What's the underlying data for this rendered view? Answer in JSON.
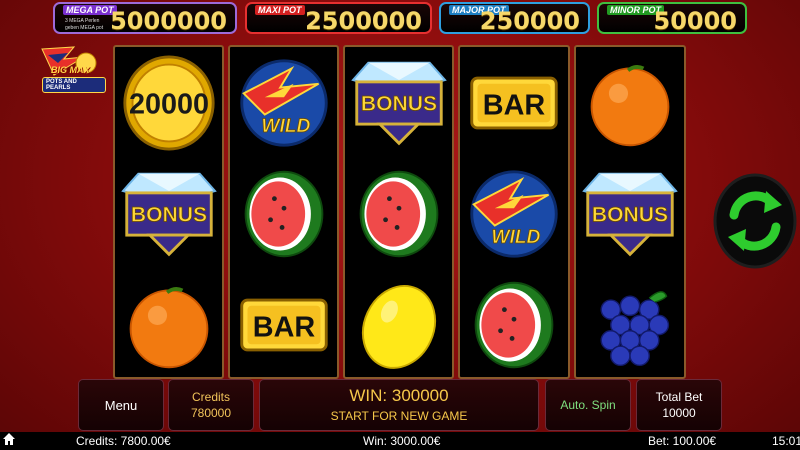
{
  "jackpots": {
    "mega": {
      "title": "MEGA POT",
      "sub1": "3 MEGA Perlen",
      "sub2": "geben MEGA pot",
      "value": "5000000"
    },
    "maxi": {
      "title": "MAXI POT",
      "value": "2500000"
    },
    "major": {
      "title": "MAJOR POT",
      "value": "250000"
    },
    "minor": {
      "title": "MINOR POT",
      "value": "50000"
    }
  },
  "logo": {
    "line1": "BIG MAX",
    "line2": "POTS AND PEARLS"
  },
  "reels": [
    [
      "coin-20000",
      "bonus-diamond",
      "orange"
    ],
    [
      "wild-wolf",
      "watermelon",
      "bar"
    ],
    [
      "bonus-diamond",
      "watermelon",
      "lemon"
    ],
    [
      "bar",
      "wild-wolf",
      "watermelon"
    ],
    [
      "orange",
      "bonus-diamond",
      "grapes"
    ]
  ],
  "symbol_text": {
    "coin": "20000",
    "bonus": "BONUS",
    "bar": "BAR",
    "wild": "WILD"
  },
  "controls": {
    "menu": "Menu",
    "credits_label": "Credits",
    "credits_value": "780000",
    "win": "WIN: 300000",
    "start": "START FOR NEW GAME",
    "auto_spin": "Auto. Spin",
    "bet_label": "Total Bet",
    "bet_value": "10000"
  },
  "status": {
    "credits": "Credits: 7800.00€",
    "win": "Win: 3000.00€",
    "bet": "Bet: 100.00€",
    "time": "15:01"
  },
  "colors": {
    "accent_gold": "#f6c84a",
    "spin_green": "#2ecc2e",
    "background_red": "#9a1010"
  }
}
